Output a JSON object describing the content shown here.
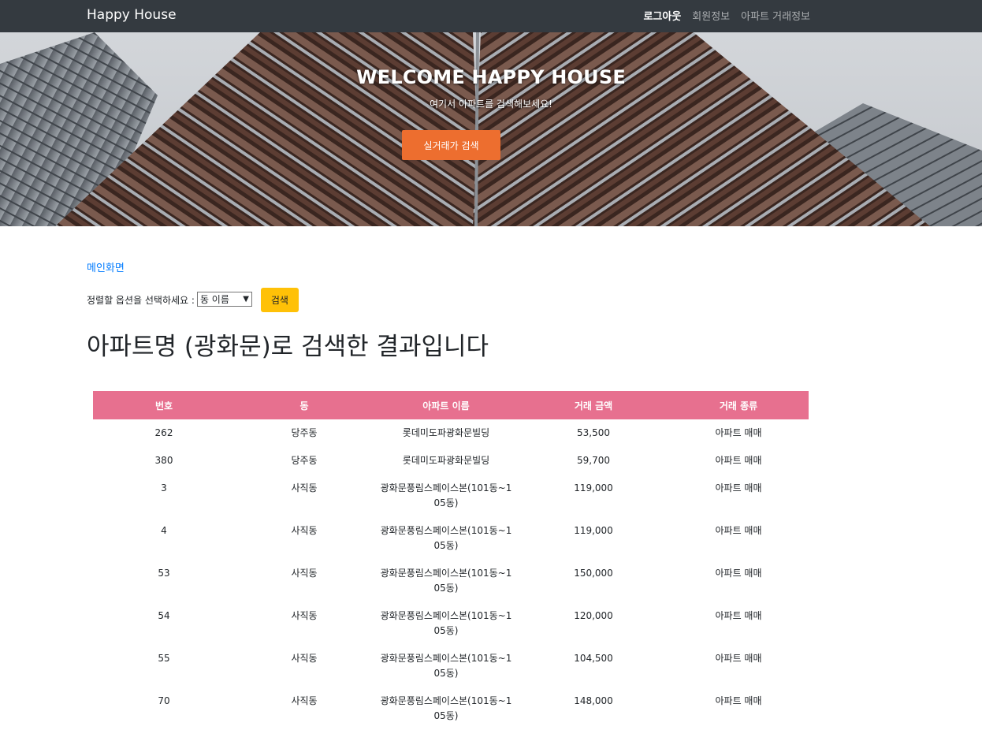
{
  "navbar": {
    "brand": "Happy House",
    "links": [
      "로그아웃",
      "회원정보",
      "아파트 거래정보"
    ]
  },
  "hero": {
    "title": "WELCOME HAPPY HOUSE",
    "subtitle": "여기서 아파트를 검색해보세요!",
    "button_label": "실거래가 검색"
  },
  "breadcrumb": "메인화면",
  "sort": {
    "label": "정렬할 옵션을 선택하세요 :",
    "selected": "동 이름",
    "button_label": "검색"
  },
  "result_heading": "아파트명 (광화문)로 검색한 결과입니다",
  "table": {
    "headers": [
      "번호",
      "동",
      "아파트 이름",
      "거래 금액",
      "거래 종류"
    ],
    "rows": [
      [
        "262",
        "당주동",
        "롯데미도파광화문빌딩",
        "53,500",
        "아파트 매매"
      ],
      [
        "380",
        "당주동",
        "롯데미도파광화문빌딩",
        "59,700",
        "아파트 매매"
      ],
      [
        "3",
        "사직동",
        "광화문풍림스페이스본(101동~105동)",
        "119,000",
        "아파트 매매"
      ],
      [
        "4",
        "사직동",
        "광화문풍림스페이스본(101동~105동)",
        "119,000",
        "아파트 매매"
      ],
      [
        "53",
        "사직동",
        "광화문풍림스페이스본(101동~105동)",
        "150,000",
        "아파트 매매"
      ],
      [
        "54",
        "사직동",
        "광화문풍림스페이스본(101동~105동)",
        "120,000",
        "아파트 매매"
      ],
      [
        "55",
        "사직동",
        "광화문풍림스페이스본(101동~105동)",
        "104,500",
        "아파트 매매"
      ],
      [
        "70",
        "사직동",
        "광화문풍림스페이스본(101동~105동)",
        "148,000",
        "아파트 매매"
      ]
    ]
  },
  "colors": {
    "navbar": "#343a40",
    "hero_button": "#ed6e2f",
    "table_header": "#e7708f",
    "search_button": "#ffc107",
    "link": "#007bff"
  }
}
